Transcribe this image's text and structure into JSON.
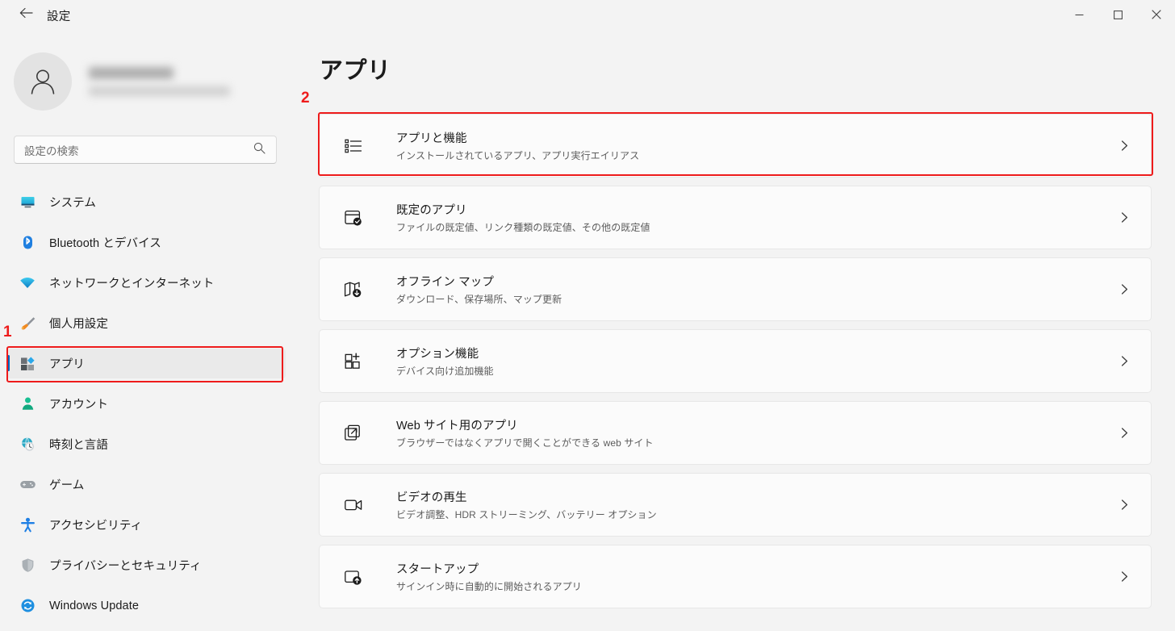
{
  "titlebar": {
    "back_icon": "back-arrow-icon",
    "title": "設定",
    "minimize_label": "—",
    "maximize_label": "□",
    "close_label": "✕"
  },
  "sidebar": {
    "profile": {
      "avatar_icon": "person-avatar-icon",
      "name_redacted": "",
      "email_redacted": ""
    },
    "search": {
      "placeholder": "設定の検索",
      "icon": "search-icon"
    },
    "items": [
      {
        "label": "システム",
        "icon": "system-monitor-icon",
        "selected": false
      },
      {
        "label": "Bluetooth とデバイス",
        "icon": "bluetooth-icon",
        "selected": false
      },
      {
        "label": "ネットワークとインターネット",
        "icon": "wifi-icon",
        "selected": false
      },
      {
        "label": "個人用設定",
        "icon": "paintbrush-icon",
        "selected": false
      },
      {
        "label": "アプリ",
        "icon": "apps-icon",
        "selected": true
      },
      {
        "label": "アカウント",
        "icon": "account-person-icon",
        "selected": false
      },
      {
        "label": "時刻と言語",
        "icon": "clock-globe-icon",
        "selected": false
      },
      {
        "label": "ゲーム",
        "icon": "gamepad-icon",
        "selected": false
      },
      {
        "label": "アクセシビリティ",
        "icon": "accessibility-icon",
        "selected": false
      },
      {
        "label": "プライバシーとセキュリティ",
        "icon": "shield-icon",
        "selected": false
      },
      {
        "label": "Windows Update",
        "icon": "update-refresh-icon",
        "selected": false
      }
    ]
  },
  "main": {
    "page_title": "アプリ",
    "cards": [
      {
        "title": "アプリと機能",
        "subtitle": "インストールされているアプリ、アプリ実行エイリアス",
        "icon": "list-bullets-icon",
        "chevron": "chevron-right-icon"
      },
      {
        "title": "既定のアプリ",
        "subtitle": "ファイルの既定値、リンク種類の既定値、その他の既定値",
        "icon": "window-check-icon",
        "chevron": "chevron-right-icon"
      },
      {
        "title": "オフライン マップ",
        "subtitle": "ダウンロード、保存場所、マップ更新",
        "icon": "map-download-icon",
        "chevron": "chevron-right-icon"
      },
      {
        "title": "オプション機能",
        "subtitle": "デバイス向け追加機能",
        "icon": "grid-plus-icon",
        "chevron": "chevron-right-icon"
      },
      {
        "title": "Web サイト用のアプリ",
        "subtitle": "ブラウザーではなくアプリで開くことができる web サイト",
        "icon": "external-link-icon",
        "chevron": "chevron-right-icon"
      },
      {
        "title": "ビデオの再生",
        "subtitle": "ビデオ調整、HDR ストリーミング、バッテリー オプション",
        "icon": "video-camera-icon",
        "chevron": "chevron-right-icon"
      },
      {
        "title": "スタートアップ",
        "subtitle": "サインイン時に自動的に開始されるアプリ",
        "icon": "startup-upload-icon",
        "chevron": "chevron-right-icon"
      }
    ]
  },
  "annotations": {
    "color": "#ee1b1b",
    "markers": [
      {
        "number": "1",
        "target": "sidebar-item-apps"
      },
      {
        "number": "2",
        "target": "card-apps-and-features"
      }
    ]
  }
}
